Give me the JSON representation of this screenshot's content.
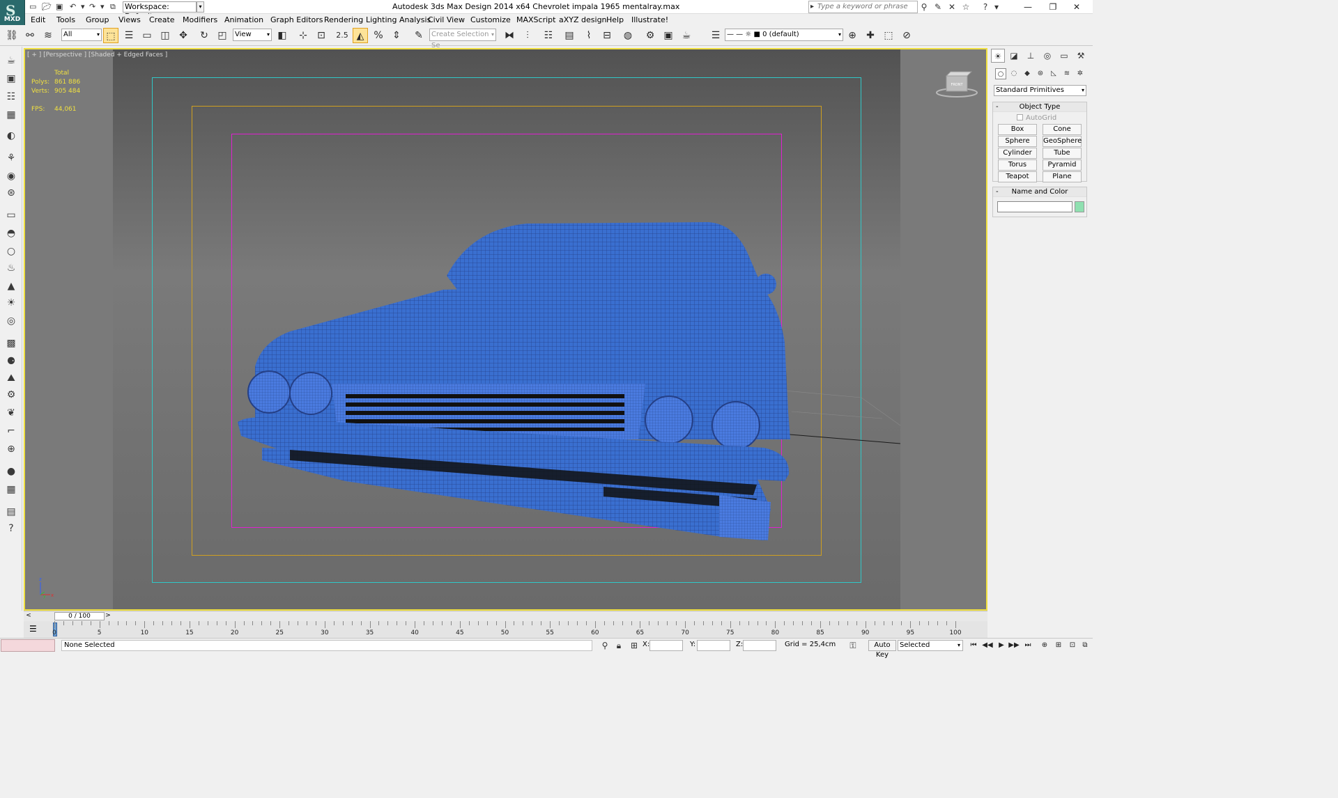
{
  "titlebar": {
    "workspace": "Workspace: Default",
    "title": "Autodesk 3ds Max Design 2014 x64     Chevrolet impala 1965 mentalray.max",
    "search_placeholder": "Type a keyword or phrase",
    "logo_text": "MXD"
  },
  "menu": [
    "Edit",
    "Tools",
    "Group",
    "Views",
    "Create",
    "Modifiers",
    "Animation",
    "Graph Editors",
    "Rendering",
    "Lighting Analysis",
    "Civil View",
    "Customize",
    "MAXScript",
    "aXYZ design",
    "Help",
    "Illustrate!"
  ],
  "toolbar": {
    "filter": "All",
    "ref_coord": "View",
    "snap_value": "2.5",
    "selection_set": "Create Selection Se",
    "layer": "0 (default)"
  },
  "viewport": {
    "label": "[ + ] [Perspective ] [Shaded + Edged Faces ]",
    "stats": {
      "total_label": "Total",
      "polys_label": "Polys:",
      "polys": "861 886",
      "verts_label": "Verts:",
      "verts": "905 484",
      "fps_label": "FPS:",
      "fps": "44,061"
    },
    "viewcube_label": "FRONT",
    "model_color": "#3a6fd0"
  },
  "command_panel": {
    "category": "Standard Primitives",
    "object_type_title": "Object Type",
    "autogrid": "AutoGrid",
    "primitives": [
      "Box",
      "Cone",
      "Sphere",
      "GeoSphere",
      "Cylinder",
      "Tube",
      "Torus",
      "Pyramid",
      "Teapot",
      "Plane"
    ],
    "name_color_title": "Name and Color",
    "object_color": "#8fe0b0"
  },
  "timeslider": {
    "frame": "0 / 100",
    "prev": "<",
    "next": ">"
  },
  "trackbar": {
    "labels": [
      "0",
      "5",
      "10",
      "15",
      "20",
      "25",
      "30",
      "35",
      "40",
      "45",
      "50",
      "55",
      "60",
      "65",
      "70",
      "75",
      "80",
      "85",
      "90",
      "95",
      "100"
    ]
  },
  "statusbar": {
    "message": "None Selected",
    "x_label": "X:",
    "y_label": "Y:",
    "z_label": "Z:",
    "grid": "Grid = 25,4cm",
    "autokey": "Auto Key",
    "key_filter": "Selected"
  }
}
